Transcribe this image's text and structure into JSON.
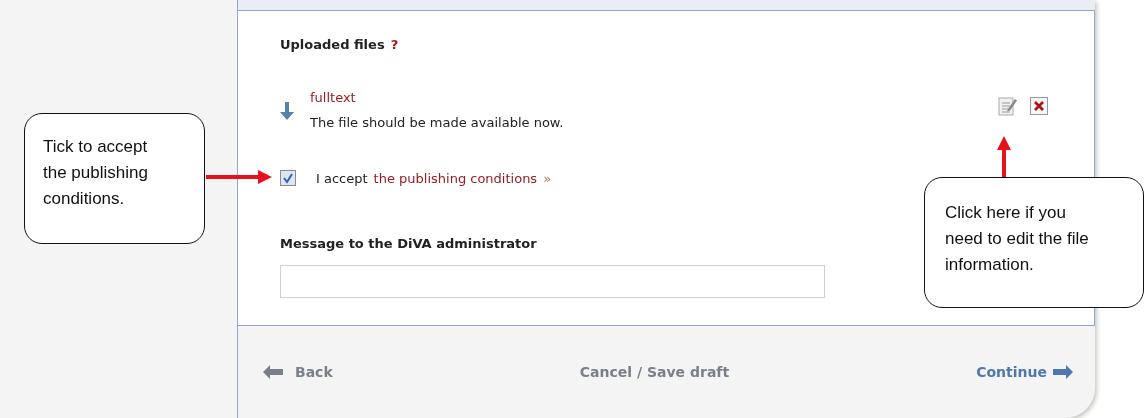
{
  "uploaded_files": {
    "title": "Uploaded files",
    "help": "?",
    "files": [
      {
        "name": "fulltext",
        "note": "The file should be made available now."
      }
    ]
  },
  "accept": {
    "checked": true,
    "text": "I accept",
    "link": "the publishing conditions",
    "link_mark": "»"
  },
  "message": {
    "label": "Message to the DiVA administrator"
  },
  "footer": {
    "back": "Back",
    "cancel": "Cancel / Save draft",
    "continue": "Continue"
  },
  "callouts": [
    {
      "text": "Tick to accept the publishing conditions."
    },
    {
      "text": "Click here if you need to edit the file information."
    }
  ]
}
